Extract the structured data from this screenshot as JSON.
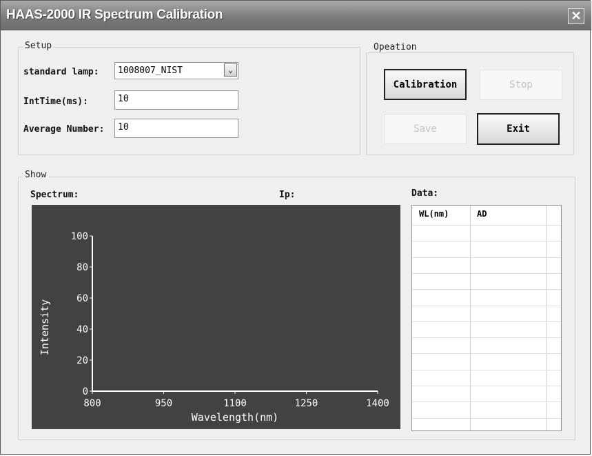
{
  "window": {
    "title": "HAAS-2000 IR Spectrum Calibration",
    "close_glyph": "✕"
  },
  "setup": {
    "legend": "Setup",
    "lamp_label": "standard lamp:",
    "lamp_value": "1008007_NIST",
    "inttime_label": "IntTime(ms):",
    "inttime_value": "10",
    "avg_label": "Average Number:",
    "avg_value": "10"
  },
  "operation": {
    "legend": "Opeation",
    "calibration_label": "Calibration",
    "stop_label": "Stop",
    "save_label": "Save",
    "exit_label": "Exit"
  },
  "show": {
    "legend": "Show",
    "spectrum_label": "Spectrum:",
    "ip_label": "Ip:",
    "data_label": "Data:",
    "table_columns": [
      "WL(nm)",
      "AD"
    ]
  },
  "chart_data": {
    "type": "line",
    "xlabel": "Wavelength(nm)",
    "ylabel": "Intensity",
    "xlim": [
      800,
      1400
    ],
    "ylim": [
      0,
      100
    ],
    "x_ticks": [
      800,
      950,
      1100,
      1250,
      1400
    ],
    "y_ticks": [
      0,
      20,
      40,
      60,
      80,
      100
    ],
    "series": [],
    "background": "#424242",
    "axis_color": "#ffffff"
  }
}
